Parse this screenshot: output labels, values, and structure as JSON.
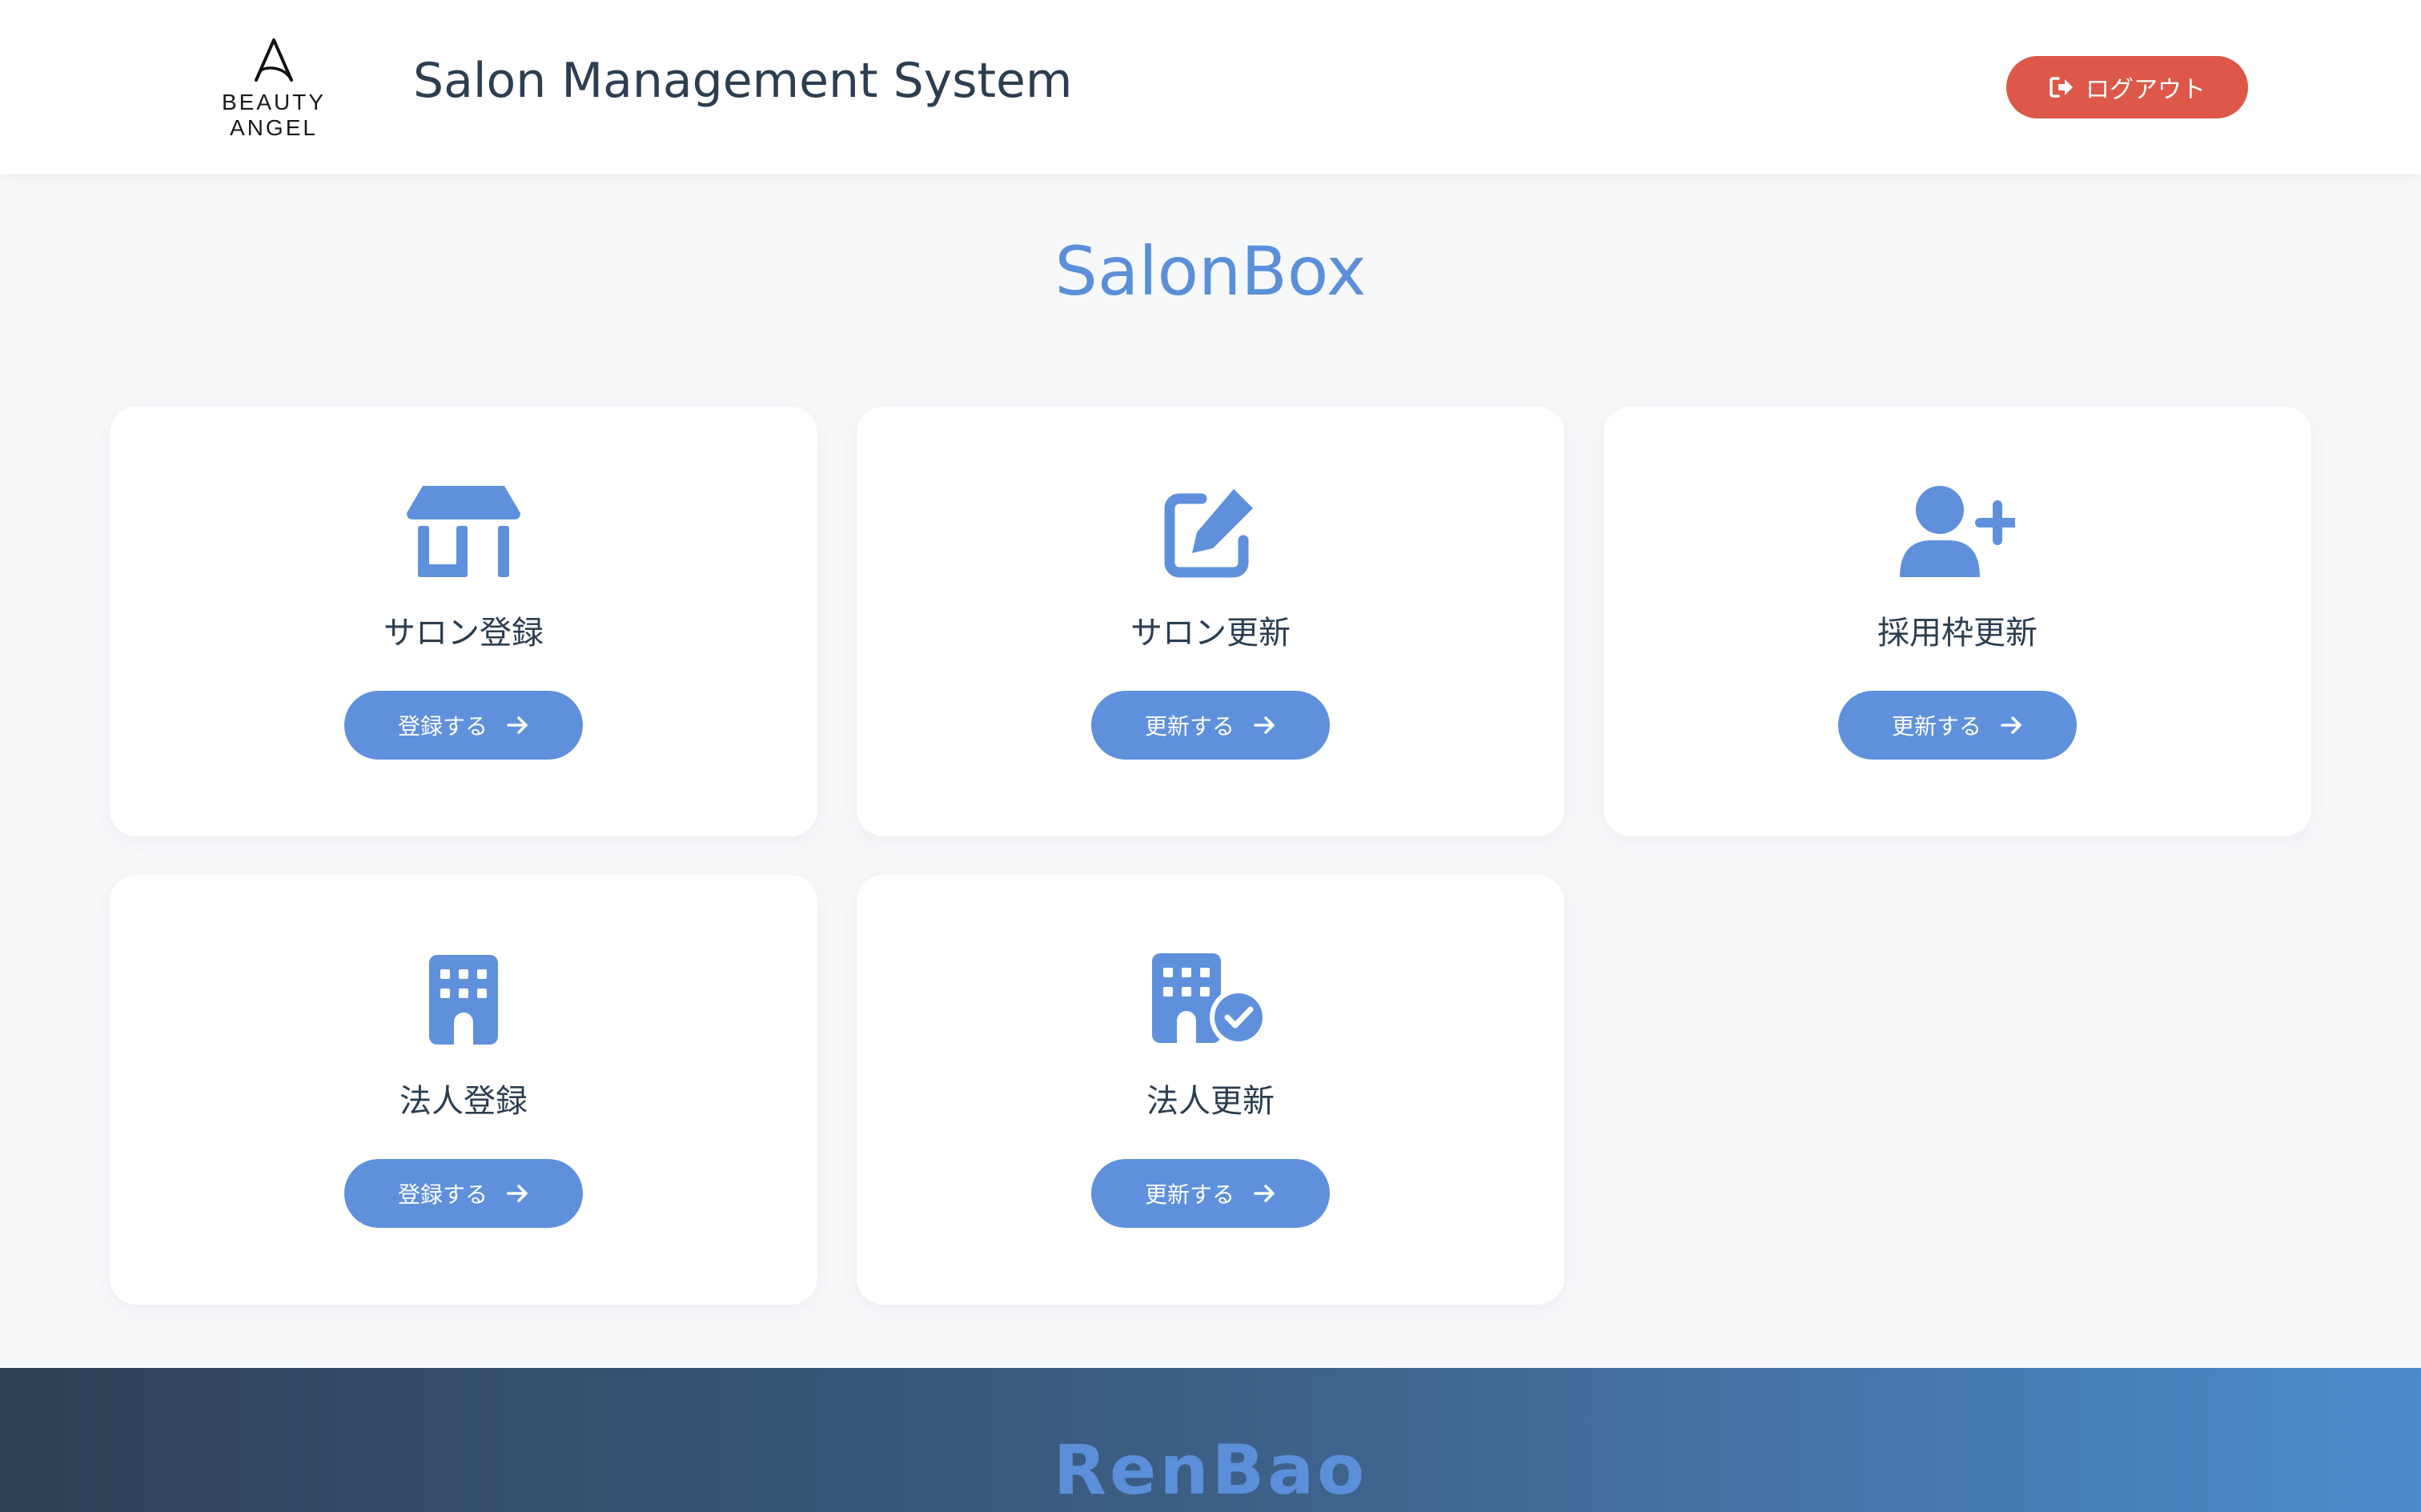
{
  "header": {
    "logo_text": "BEAUTY ANGEL",
    "app_title": "Salon Management System",
    "logout_label": "ログアウト"
  },
  "main": {
    "title": "SalonBox",
    "cards": [
      {
        "icon": "store-icon",
        "label": "サロン登録",
        "button_label": "登録する"
      },
      {
        "icon": "edit-icon",
        "label": "サロン更新",
        "button_label": "更新する"
      },
      {
        "icon": "user-plus-icon",
        "label": "採用枠更新",
        "button_label": "更新する"
      },
      {
        "icon": "building-icon",
        "label": "法人登録",
        "button_label": "登録する"
      },
      {
        "icon": "building-check-icon",
        "label": "法人更新",
        "button_label": "更新する"
      }
    ]
  },
  "footer": {
    "brand": "RenBao"
  },
  "colors": {
    "accent": "#5f90dc",
    "title_blue": "#5b8fd9",
    "logout_red": "#dd5848",
    "text_dark": "#2c3e50"
  }
}
